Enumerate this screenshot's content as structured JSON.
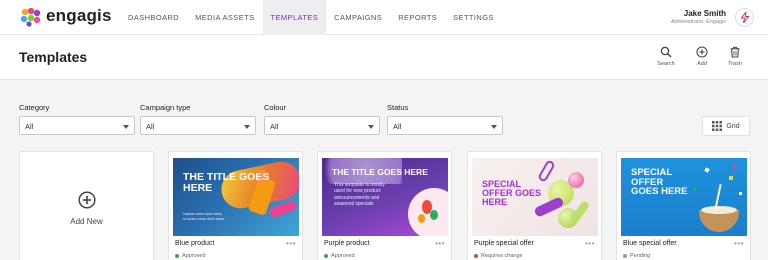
{
  "app": {
    "logo_text": "engagis"
  },
  "nav": {
    "items": [
      {
        "label": "DASHBOARD"
      },
      {
        "label": "MEDIA ASSETS"
      },
      {
        "label": "TEMPLATES"
      },
      {
        "label": "CAMPAIGNS"
      },
      {
        "label": "REPORTS"
      },
      {
        "label": "SETTINGS"
      }
    ],
    "active": "TEMPLATES"
  },
  "user": {
    "name": "Jake Smith",
    "role": "Administrator, Engagis"
  },
  "page": {
    "title": "Templates"
  },
  "actions": {
    "search": "Search",
    "add": "Add",
    "trash": "Trash"
  },
  "filters": [
    {
      "label": "Category",
      "value": "All"
    },
    {
      "label": "Campaign type",
      "value": "All"
    },
    {
      "label": "Colour",
      "value": "All"
    },
    {
      "label": "Status",
      "value": "All"
    }
  ],
  "view": {
    "label": "Grid"
  },
  "add_new": {
    "label": "Add New"
  },
  "cards": [
    {
      "title": "Blue product",
      "status": "Approved",
      "status_color": "#3aa655",
      "headline": "THE TITLE GOES HERE",
      "body": "Imphas amet dolor deep\nsit amet conse dolor amet"
    },
    {
      "title": "Purple product",
      "status": "Approved",
      "status_color": "#3aa655",
      "headline": "THE TITLE GOES HERE",
      "body": "This template is mostly used for new product announcements and seasonal specials"
    },
    {
      "title": "Purple special offer",
      "status": "Requires change",
      "status_color": "#d64545",
      "headline": "SPECIAL OFFER GOES HERE",
      "body": ""
    },
    {
      "title": "Blue special offer",
      "status": "Pending",
      "status_color": "#9a9a9a",
      "headline": "SPECIAL OFFER GOES HERE",
      "body": ""
    }
  ],
  "more_label": "•••",
  "colors": {
    "accent": "#7a2ea8",
    "approved": "#3aa655",
    "requires_change": "#d64545",
    "pending": "#9a9a9a"
  }
}
